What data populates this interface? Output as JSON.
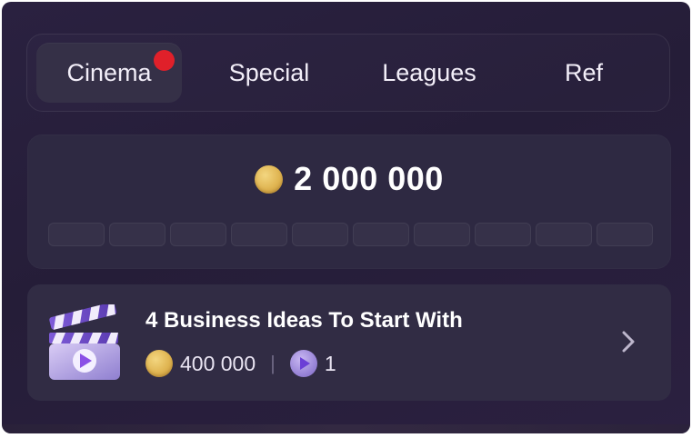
{
  "tabs": [
    {
      "label": "Cinema",
      "active": true,
      "notification_dot": true
    },
    {
      "label": "Special",
      "active": false
    },
    {
      "label": "Leagues",
      "active": false
    },
    {
      "label": "Ref",
      "active": false
    }
  ],
  "balance": {
    "value": "2 000 000",
    "icon": "coin-icon",
    "progress_segments_total": 10,
    "progress_segments_filled": 0
  },
  "task": {
    "icon": "clapperboard-icon",
    "title": "4 Business Ideas To Start With",
    "coin_reward": "400 000",
    "separator": "|",
    "ticket_reward": "1",
    "action_icon": "chevron-right-icon"
  },
  "colors": {
    "background": "#261e39",
    "card": "#2e2942",
    "active_tab": "#353047",
    "notification": "#e0202a",
    "coin": "#e0b552",
    "ticket": "#9a86d8"
  }
}
